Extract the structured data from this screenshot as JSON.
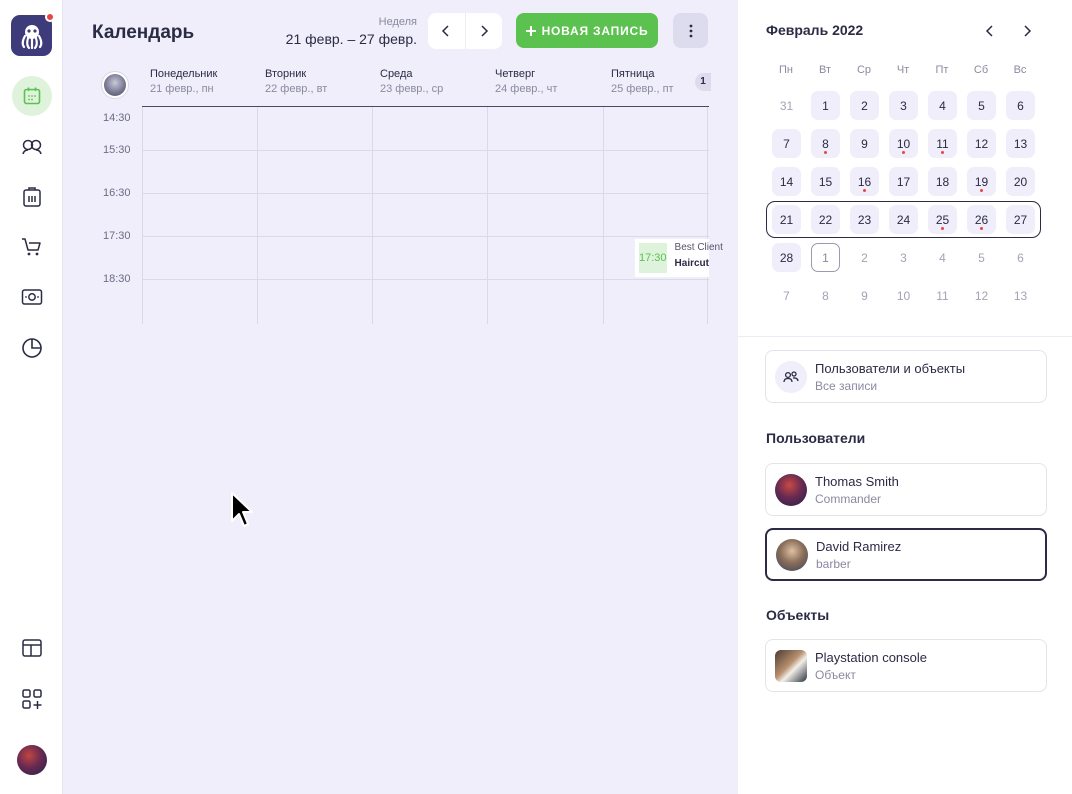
{
  "sidebar": {
    "items": [
      {
        "name": "calendar-icon",
        "active": true
      },
      {
        "name": "clients-icon"
      },
      {
        "name": "inventory-icon"
      },
      {
        "name": "cart-icon"
      },
      {
        "name": "money-icon"
      },
      {
        "name": "pie-chart-icon"
      },
      {
        "name": "layout-icon"
      },
      {
        "name": "add-widget-icon"
      }
    ]
  },
  "header": {
    "title": "Календарь",
    "week_label": "Неделя",
    "week_range": "21 февр. – 27 февр.",
    "new_record_label": "НОВАЯ ЗАПИСЬ"
  },
  "calendar": {
    "days": [
      {
        "name": "Понедельник",
        "date": "21 февр., пн"
      },
      {
        "name": "Вторник",
        "date": "22 февр., вт"
      },
      {
        "name": "Среда",
        "date": "23 февр., ср"
      },
      {
        "name": "Четверг",
        "date": "24 февр., чт"
      },
      {
        "name": "Пятница",
        "date": "25 февр., пт"
      }
    ],
    "more_days_badge": "1",
    "times": [
      "14:30",
      "15:30",
      "16:30",
      "17:30",
      "18:30"
    ],
    "event": {
      "time": "17:30",
      "client": "Best Client",
      "service": "Haircut"
    }
  },
  "mini_calendar": {
    "title": "Февраль 2022",
    "weekdays": [
      "Пн",
      "Вт",
      "Ср",
      "Чт",
      "Пт",
      "Сб",
      "Вс"
    ]
  },
  "filter": {
    "title": "Пользователи и объекты",
    "subtitle": "Все записи"
  },
  "users": {
    "heading": "Пользователи",
    "items": [
      {
        "name": "Thomas Smith",
        "role": "Commander"
      },
      {
        "name": "David Ramirez",
        "role": "barber"
      }
    ]
  },
  "objects": {
    "heading": "Объекты",
    "items": [
      {
        "name": "Playstation console",
        "type": "Объект"
      }
    ]
  },
  "colors": {
    "accent_green": "#5bc14f",
    "dark": "#2b2b45",
    "red_dot": "#e94545",
    "bg_lavender": "#efeefa"
  }
}
